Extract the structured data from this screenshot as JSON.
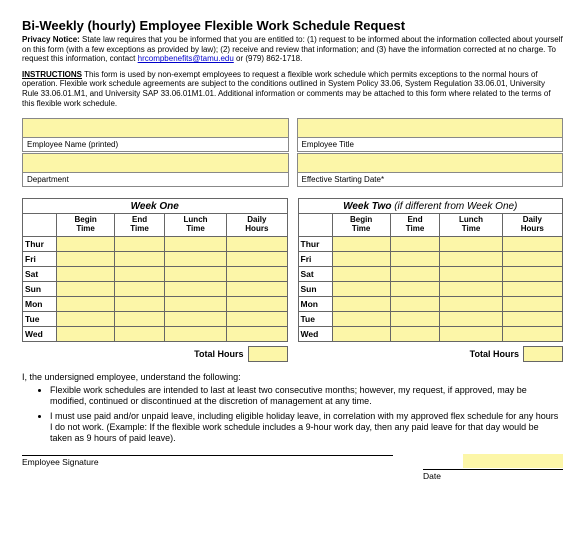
{
  "title": "Bi-Weekly (hourly) Employee Flexible Work Schedule Request",
  "privacy": {
    "label": "Privacy Notice:",
    "body_a": " State law requires that you be informed that you are entitled to: (1) request to be informed about the information collected about yourself on this form (with a few exceptions as provided by law); (2) receive and review that information; and (3) have the information corrected at no charge. To request this information, contact ",
    "link": "hrcompbenefits@tamu.edu",
    "body_b": "  or (979) 862-1718."
  },
  "instructions": {
    "label": "INSTRUCTIONS",
    "body": " This form is used by non-exempt employees to request a flexible work schedule which permits exceptions to the normal hours of operation.  Flexible work schedule agreements are subject to the conditions outlined in System Policy 33.06, System Regulation 33.06.01, University Rule 33.06.01.M1, and University SAP 33.06.01M1.01. Additional information or comments may be attached to this form where related to the terms of this flexible work schedule."
  },
  "info": {
    "name_label": "Employee Name (printed)",
    "dept_label": "Department",
    "title_label": "Employee Title",
    "date_label": "Effective Starting Date*"
  },
  "columns": {
    "c0": "",
    "c1a": "Begin",
    "c1b": "Time",
    "c2a": "End",
    "c2b": "Time",
    "c3a": "Lunch",
    "c3b": "Time",
    "c4a": "Daily",
    "c4b": "Hours"
  },
  "week1": {
    "title": "Week One",
    "days": [
      "Thur",
      "Fri",
      "Sat",
      "Sun",
      "Mon",
      "Tue",
      "Wed"
    ],
    "total_label": "Total Hours"
  },
  "week2": {
    "title": "Week Two ",
    "hint": "(if different from Week One)",
    "days": [
      "Thur",
      "Fri",
      "Sat",
      "Sun",
      "Mon",
      "Tue",
      "Wed"
    ],
    "total_label": "Total Hours"
  },
  "ack": {
    "intro": "I, the undersigned employee, understand the following:",
    "b1": "Flexible work schedules are intended to last at least two consecutive months; however, my request, if approved, may be modified, continued or discontinued at the discretion of management at any time.",
    "b2": "I must use paid and/or unpaid leave, including eligible holiday leave, in correlation with my approved flex schedule for any hours I do not work. (Example: If the flexible work schedule includes a 9-hour work day, then any paid leave for that day would be taken as 9 hours of paid leave)."
  },
  "sig": {
    "name": "Employee Signature",
    "date": "Date"
  }
}
